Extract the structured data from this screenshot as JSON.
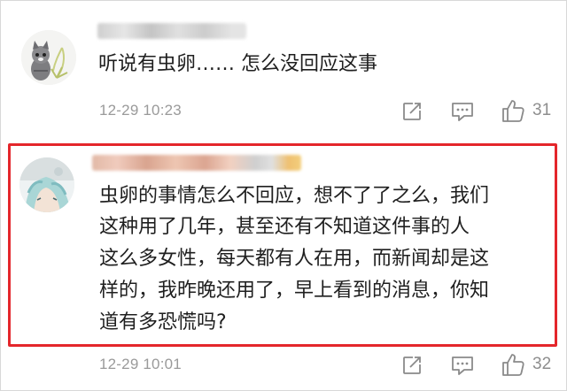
{
  "comments": [
    {
      "text": "听说有虫卵…… 怎么没回应这事",
      "time": "12-29 10:23",
      "likes": "31",
      "avatar_icon": "cat-avatar"
    },
    {
      "lines": [
        "虫卵的事情怎么不回应，想不了了之么，我们",
        "这种用了几年，甚至还有不知道这件事的人",
        "这么多女性，每天都有人在用，而新闻却是这",
        "样的，我昨晚还用了，早上看到的消息，你知",
        "道有多恐慌吗?"
      ],
      "time": "12-29 10:01",
      "likes": "32",
      "avatar_icon": "anime-girl-avatar",
      "highlighted": true
    }
  ],
  "icons": {
    "share": "share-icon",
    "reply": "comment-icon",
    "like": "thumbs-up-icon"
  },
  "colors": {
    "highlight": "#e4262b",
    "meta_text": "#9a9a9a",
    "icon": "#8a8a8a"
  }
}
